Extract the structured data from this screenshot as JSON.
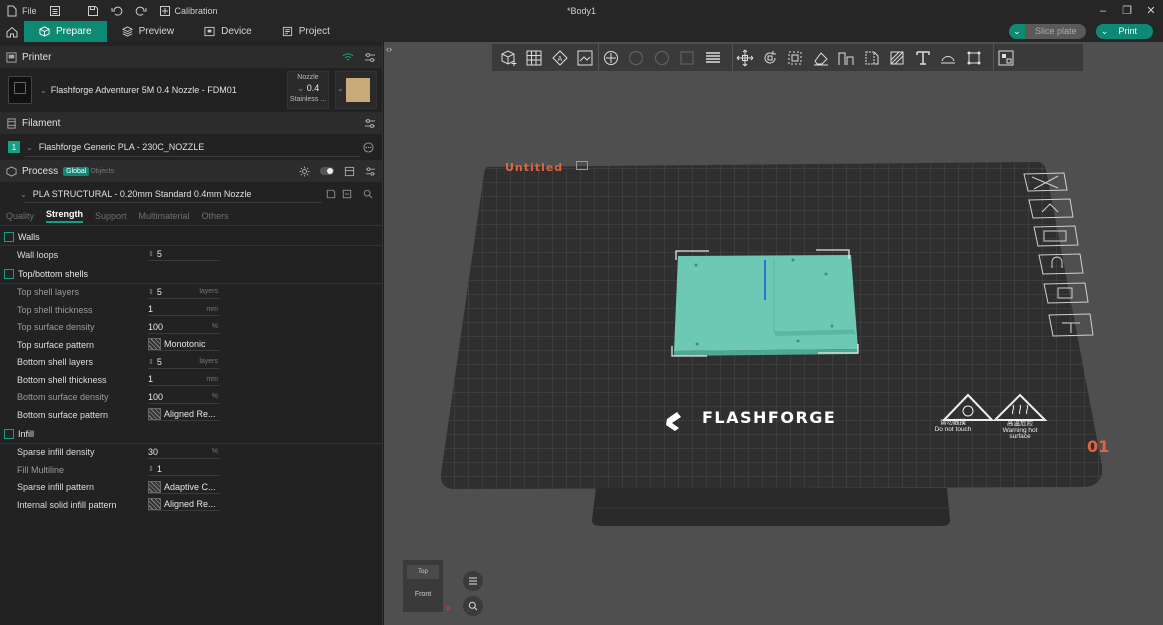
{
  "titlebar": {
    "file_label": "File",
    "calibration_label": "Calibration",
    "document_title": "*Body1"
  },
  "navbar": {
    "tabs": [
      {
        "label": "Prepare",
        "icon": "cube-icon"
      },
      {
        "label": "Preview",
        "icon": "layers-icon"
      },
      {
        "label": "Device",
        "icon": "monitor-icon"
      },
      {
        "label": "Project",
        "icon": "document-icon"
      }
    ],
    "slice_label": "Slice plate",
    "print_label": "Print"
  },
  "printer": {
    "section_title": "Printer",
    "name": "Flashforge Adventurer 5M 0.4 Nozzle - FDM01",
    "nozzle_label": "Nozzle",
    "nozzle_value": "0.4",
    "nozzle_material": "Stainless ..."
  },
  "filament": {
    "section_title": "Filament",
    "index": "1",
    "name": "Flashforge Generic PLA - 230C_NOZZLE"
  },
  "process": {
    "section_title": "Process",
    "global_label": "Global",
    "objects_label": "Objects",
    "preset": "PLA STRUCTURAL - 0.20mm Standard 0.4mm Nozzle",
    "tabs": [
      "Quality",
      "Strength",
      "Support",
      "Multimaterial",
      "Others"
    ],
    "active_tab": "Strength"
  },
  "groups": {
    "walls": {
      "title": "Walls",
      "wall_loops": {
        "label": "Wall loops",
        "value": "5"
      }
    },
    "shells": {
      "title": "Top/bottom shells",
      "top_layers": {
        "label": "Top shell layers",
        "value": "5",
        "unit": "layers"
      },
      "top_thickness": {
        "label": "Top shell thickness",
        "value": "1",
        "unit": "mm"
      },
      "top_density": {
        "label": "Top surface density",
        "value": "100",
        "unit": "%"
      },
      "top_pattern": {
        "label": "Top surface pattern",
        "value": "Monotonic"
      },
      "bottom_layers": {
        "label": "Bottom shell layers",
        "value": "5",
        "unit": "layers"
      },
      "bottom_thickness": {
        "label": "Bottom shell thickness",
        "value": "1",
        "unit": "mm"
      },
      "bottom_density": {
        "label": "Bottom surface density",
        "value": "100",
        "unit": "%"
      },
      "bottom_pattern": {
        "label": "Bottom surface pattern",
        "value": "Aligned Re..."
      }
    },
    "infill": {
      "title": "Infill",
      "density": {
        "label": "Sparse infill density",
        "value": "30",
        "unit": "%"
      },
      "multiline": {
        "label": "Fill Multiline",
        "value": "1"
      },
      "pattern": {
        "label": "Sparse infill pattern",
        "value": "Adaptive C..."
      },
      "solid_pattern": {
        "label": "Internal solid infill pattern",
        "value": "Aligned Re..."
      }
    }
  },
  "plate": {
    "name": "Untitled",
    "brand": "FLASHFORGE",
    "number": "01",
    "warning_1_cn": "请勿触摸",
    "warning_1_en": "Do not touch",
    "warning_2_cn": "高温危险",
    "warning_2_en": "Warning hot",
    "warning_2_en2": "surface"
  },
  "axis": {
    "top_label": "Top",
    "front_label": "Front"
  },
  "colors": {
    "accent": "#0e8a74",
    "model": "#6ec9b4",
    "plate_number": "#e0643c"
  }
}
